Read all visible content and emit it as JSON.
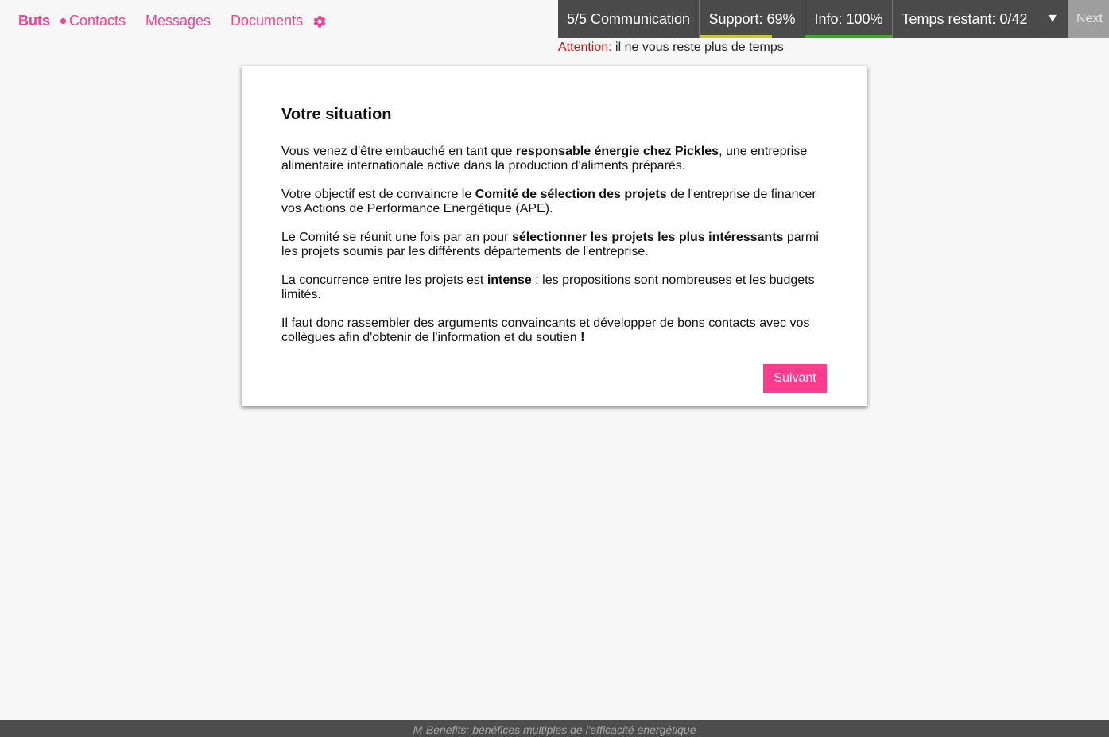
{
  "nav": {
    "buts": "Buts",
    "contacts": "Contacts",
    "messages": "Messages",
    "documents": "Documents",
    "settings_icon": "gear-icon"
  },
  "status": {
    "communication": "5/5 Communication",
    "support": "Support: 69%",
    "support_level": 0.69,
    "support_color": "#d4c42b",
    "info": "Info: 100%",
    "info_level": 1.0,
    "info_color": "#3fa62b",
    "temps": "Temps restant: 0/42",
    "toggle": "▼",
    "next": "Next"
  },
  "warning": {
    "label": "Attention:",
    "text": " il ne vous reste plus de temps"
  },
  "card": {
    "title": "Votre situation",
    "p1": {
      "a": "Vous venez d'être embauché en tant que ",
      "b": "responsable énergie chez Pickles",
      "c": ", une entreprise alimentaire internationale active dans la production d'aliments préparés."
    },
    "p2": {
      "a": "Votre objectif est de convaincre le ",
      "b": "Comité de sélection des projets",
      "c": " de l'entreprise de financer vos Actions de Performance Energétique (APE)."
    },
    "p3": {
      "a": "Le Comité se réunit une fois par an pour ",
      "b": "sélectionner les projets les plus intéressants",
      "c": " parmi les projets soumis par les différents départements de l'entreprise."
    },
    "p4": {
      "a": "La concurrence entre les projets est ",
      "b": "intense",
      "c": " : les propositions sont nombreuses et les budgets limités."
    },
    "p5": {
      "a": "Il faut donc rassembler des arguments convaincants et développer de bons contacts avec vos collègues afin d'obtenir de l'information et du soutien ",
      "b": "!"
    },
    "button": "Suivant"
  },
  "footer": {
    "text": "M-Benefits: bénéfices multiples de l'efficacité énergétique"
  },
  "colors": {
    "accent": "#ff3b8d",
    "bar_bg": "#4a4a4a",
    "warning": "#d91010"
  }
}
